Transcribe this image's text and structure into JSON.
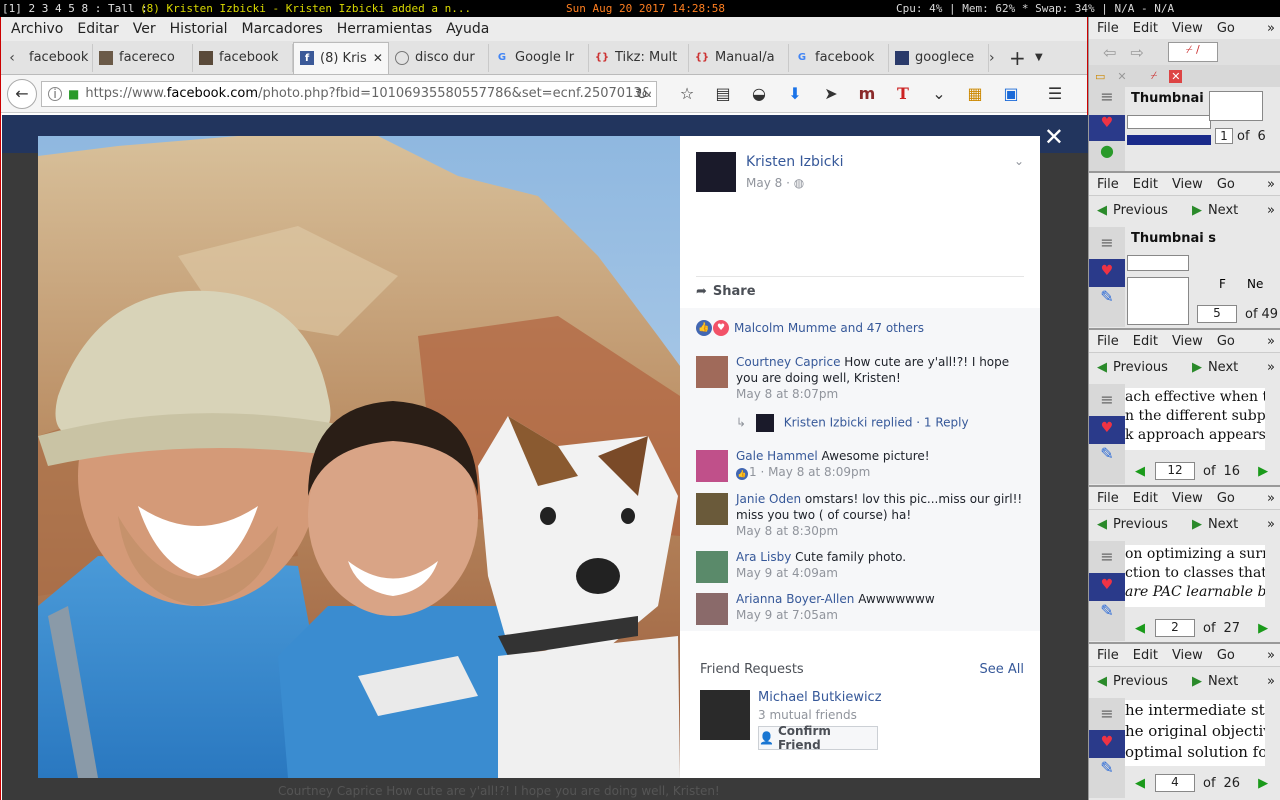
{
  "topbar": {
    "workspaces": "[1] 2 3 4 5 8 : Tall : ",
    "title": "(8) Kristen Izbicki - Kristen Izbicki added a n...",
    "datetime": "Sun Aug 20 2017 14:28:58",
    "stats": "Cpu: 4% | Mem: 62% * Swap: 34% | N/A - N/A"
  },
  "firefox": {
    "menu": [
      "Archivo",
      "Editar",
      "Ver",
      "Historial",
      "Marcadores",
      "Herramientas",
      "Ayuda"
    ],
    "tabs": [
      {
        "label": "facebook",
        "icon": "image-icon"
      },
      {
        "label": "facereco",
        "icon": "image-icon"
      },
      {
        "label": "facebook",
        "icon": "image-icon"
      },
      {
        "label": "(8) Kris",
        "icon": "facebook-icon"
      },
      {
        "label": "disco dur",
        "icon": "disk-icon"
      },
      {
        "label": "Google Ir",
        "icon": "google-icon"
      },
      {
        "label": "Tikz: Mult",
        "icon": "braces-icon"
      },
      {
        "label": "Manual/a",
        "icon": "braces-icon"
      },
      {
        "label": "facebook",
        "icon": "google-icon"
      },
      {
        "label": "googlece",
        "icon": "image-icon"
      }
    ],
    "url_prefix": "https://www.",
    "url_domain": "facebook.com",
    "url_rest": "/photo.php?fbid=10106935580557786&set=ecnf.2507013&"
  },
  "facebook": {
    "author": "Kristen Izbicki",
    "post_date": "May 8 · ",
    "share_label": "Share",
    "likes_text": "Malcolm Mumme and 47 others",
    "comments": [
      {
        "name": "Courtney Caprice",
        "text": "How cute are y'all!?! I hope you are doing well, Kristen!",
        "meta": "May 8 at 8:07pm"
      },
      {
        "name": "Gale Hammel",
        "text": "Awesome picture!",
        "meta": "1 · May 8 at 8:09pm"
      },
      {
        "name": "Janie Oden",
        "text": "omstars! lov this pic...miss our girl!! miss you two ( of course) ha!",
        "meta": "May 8 at 8:30pm"
      },
      {
        "name": "Ara Lisby",
        "text": "Cute family photo.",
        "meta": "May 9 at 4:09am"
      },
      {
        "name": "Arianna Boyer-Allen",
        "text": "Awwwwwww",
        "meta": "May 9 at 7:05am"
      }
    ],
    "reply": {
      "name": "Kristen Izbicki",
      "text": "replied · 1 Reply"
    },
    "friend_requests": {
      "heading": "Friend Requests",
      "see_all": "See All",
      "name": "Michael Butkiewicz",
      "mutual": "3 mutual friends",
      "confirm": "Confirm Friend"
    },
    "behind_text": "Courtney Caprice How cute are y'all!?! I hope you are doing well, Kristen!"
  },
  "right_panels": {
    "menu": [
      "File",
      "Edit",
      "View",
      "Go"
    ],
    "thumbnails_label": "Thumbnai",
    "thumbnails_label2": "Thumbnai s",
    "previous": "Previous",
    "next": "Next",
    "of": "of",
    "p1": {
      "page": "1",
      "total": "6"
    },
    "p2": {
      "page": "5",
      "total": "49",
      "prefix": "F",
      "ne": "Ne"
    },
    "p3": {
      "page": "12",
      "total": "16",
      "lines": [
        "ach effective when the",
        "n the different subpro",
        "k approach appears m"
      ]
    },
    "p4": {
      "page": "2",
      "total": "27",
      "lines": [
        "on optimizing a surrog",
        "ction to classes that are",
        "are PAC learnable be op"
      ]
    },
    "p5": {
      "page": "4",
      "total": "26",
      "lines": [
        "he intermediate step",
        "he original objective",
        "optimal solution for"
      ]
    }
  }
}
